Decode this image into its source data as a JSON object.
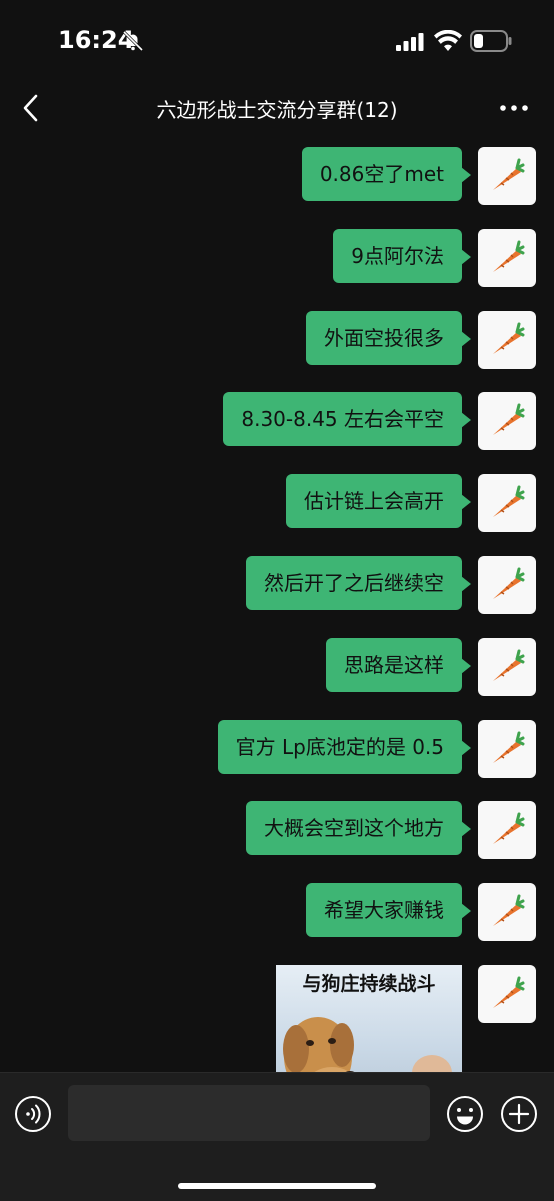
{
  "status": {
    "time": "16:24"
  },
  "header": {
    "title": "六边形战士交流分享群(12)"
  },
  "messages": [
    "0.86空了met",
    "9点阿尔法",
    "外面空投很多",
    "8.30-8.45 左右会平空",
    "估计链上会高开",
    "然后开了之后继续空",
    "思路是这样",
    "官方 Lp底池定的是 0.5",
    "大概会空到这个地方",
    "希望大家赚钱"
  ],
  "sticker": {
    "caption": "与狗庄持续战斗"
  },
  "input": {
    "value": ""
  },
  "colors": {
    "bubble": "#3eb574",
    "background": "#111111",
    "avatar_bg": "#f8f8f8"
  },
  "icons": [
    "bell-slash-icon",
    "signal-icon",
    "wifi-icon",
    "battery-icon",
    "back-chevron-icon",
    "more-icon",
    "carrot-avatar-icon",
    "voice-icon",
    "emoji-icon",
    "plus-icon"
  ]
}
